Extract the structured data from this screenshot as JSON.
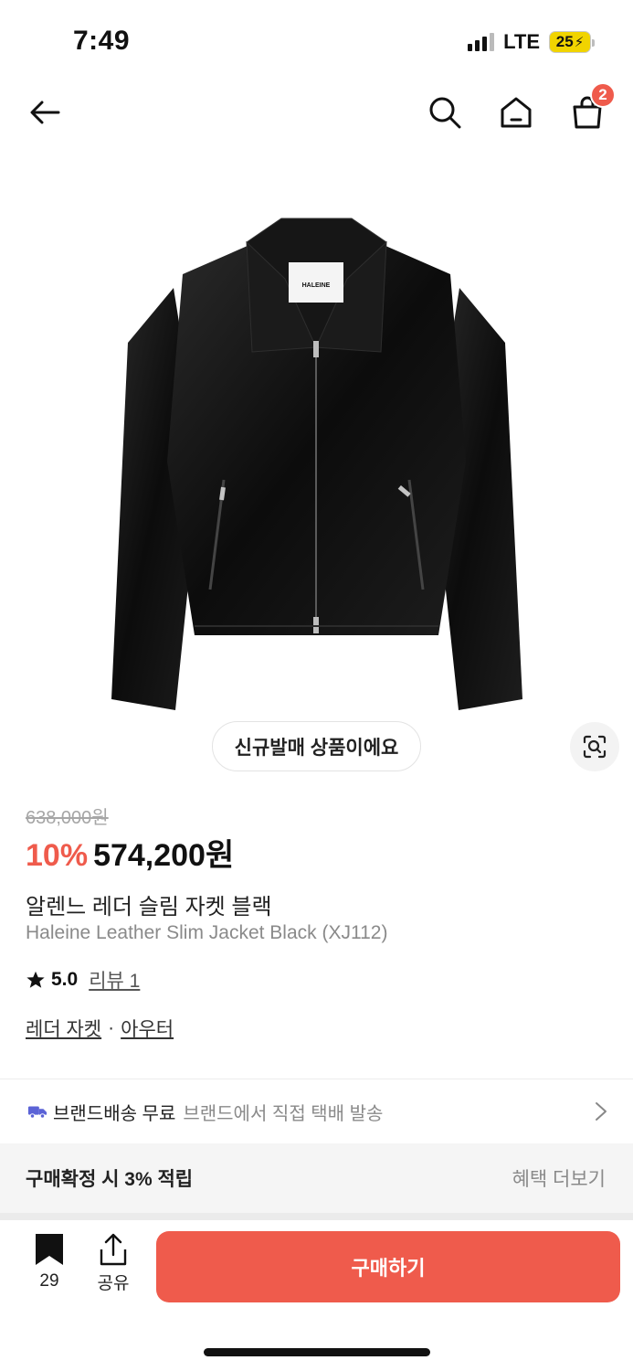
{
  "status_bar": {
    "time": "7:49",
    "network": "LTE",
    "battery": "25"
  },
  "nav": {
    "cart_count": "2"
  },
  "product": {
    "image_label": "HALEINE",
    "new_badge": "신규발매 상품이에요",
    "original_price": "638,000원",
    "discount": "10%",
    "price": "574,200원",
    "name_ko": "알렌느 레더 슬림 자켓 블랙",
    "name_en": "Haleine Leather Slim Jacket Black (XJ112)",
    "rating": "5.0",
    "review_label": "리뷰 1",
    "categories": [
      "레더 자켓",
      "아우터"
    ],
    "category_separator": "·"
  },
  "shipping": {
    "title": "브랜드배송 무료",
    "description": "브랜드에서 직접 택배 발송"
  },
  "reward": {
    "title": "구매확정 시 3% 적립",
    "more": "혜택 더보기"
  },
  "bottom": {
    "bookmark_count": "29",
    "share_label": "공유",
    "buy_label": "구매하기"
  },
  "colors": {
    "accent": "#ef5b4c",
    "shipping_icon": "#5b63d6"
  },
  "icons": [
    "back-arrow-icon",
    "search-icon",
    "home-icon",
    "shopping-bag-icon",
    "lens-search-icon",
    "truck-icon",
    "chevron-right-icon",
    "bookmark-icon",
    "share-icon",
    "star-icon"
  ]
}
